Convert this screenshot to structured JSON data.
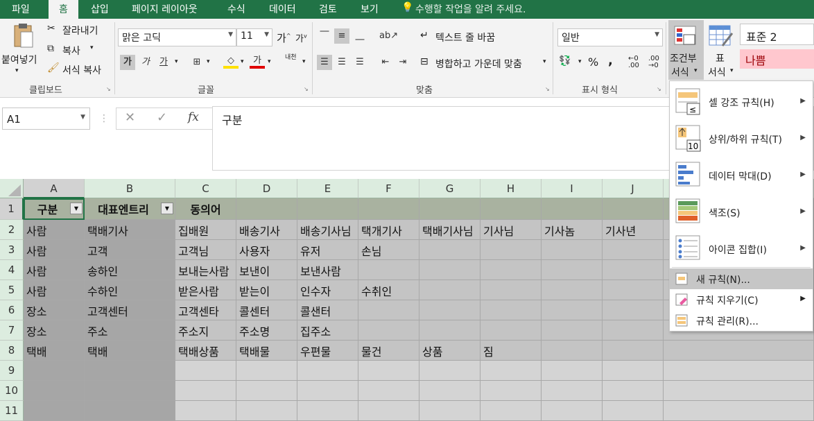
{
  "tabs": [
    "파일",
    "홈",
    "삽입",
    "페이지 레이아웃",
    "수식",
    "데이터",
    "검토",
    "보기"
  ],
  "tell_me": "수행할 작업을 알려 주세요.",
  "clipboard": {
    "paste": "붙여넣기",
    "cut": "잘라내기",
    "copy": "복사",
    "format_painter": "서식 복사",
    "group": "클립보드"
  },
  "font": {
    "name": "맑은 고딕",
    "size": "11",
    "group": "글꼴",
    "bold": "가",
    "italic": "가",
    "underline": "가",
    "ruby": "내천",
    "grow": "가",
    "shrink": "가"
  },
  "alignment": {
    "wrap": "텍스트 줄 바꿈",
    "merge": "병합하고 가운데 맞춤",
    "group": "맞춤"
  },
  "number": {
    "format": "일반",
    "group": "표시 형식",
    "percent": "%",
    "comma": ","
  },
  "styles": {
    "conditional": "조건부",
    "conditional2": "서식",
    "table": "표",
    "table2": "서식",
    "style1": "표준 2",
    "style2": "나쁨"
  },
  "name_box": "A1",
  "formula": "구분",
  "columns": [
    "A",
    "B",
    "C",
    "D",
    "E",
    "F",
    "G",
    "H",
    "I",
    "J"
  ],
  "rows": [
    "1",
    "2",
    "3",
    "4",
    "5",
    "6",
    "7",
    "8",
    "9",
    "10",
    "11"
  ],
  "cells": {
    "r1": [
      "구분",
      "대표엔트리",
      "동의어",
      "",
      "",
      "",
      "",
      "",
      "",
      ""
    ],
    "r2": [
      "사람",
      "택배기사",
      "집배원",
      "배송기사",
      "배송기사님",
      "택개기사",
      "택배기사님",
      "기사님",
      "기사놈",
      "기사년"
    ],
    "r3": [
      "사람",
      "고객",
      "고객님",
      "사용자",
      "유저",
      "손님",
      "",
      "",
      "",
      ""
    ],
    "r4": [
      "사람",
      "송하인",
      "보내는사람",
      "보낸이",
      "보낸사람",
      "",
      "",
      "",
      "",
      ""
    ],
    "r5": [
      "사람",
      "수하인",
      "받은사람",
      "받는이",
      "인수자",
      "수취인",
      "",
      "",
      "",
      ""
    ],
    "r6": [
      "장소",
      "고객센터",
      "고객센타",
      "콜센터",
      "콜샌터",
      "",
      "",
      "",
      "",
      ""
    ],
    "r7": [
      "장소",
      "주소",
      "주소지",
      "주소명",
      "집주소",
      "",
      "",
      "",
      "",
      ""
    ],
    "r8": [
      "택배",
      "택배",
      "택배상품",
      "택배물",
      "우편물",
      "물건",
      "상품",
      "짐",
      "",
      ""
    ]
  },
  "menu": {
    "items": [
      "셀 강조 규칙(H)",
      "상위/하위 규칙(T)",
      "데이터 막대(D)",
      "색조(S)",
      "아이콘 집합(I)"
    ],
    "small": [
      "새 규칙(N)...",
      "규칙 지우기(C)",
      "규칙 관리(R)..."
    ]
  },
  "colors": {
    "excel_green": "#217346",
    "header_fill": "#c4c4c4",
    "title_fill": "#a9b2a0",
    "bad_fill": "#ffc7ce",
    "bad_text": "#9c0006"
  }
}
